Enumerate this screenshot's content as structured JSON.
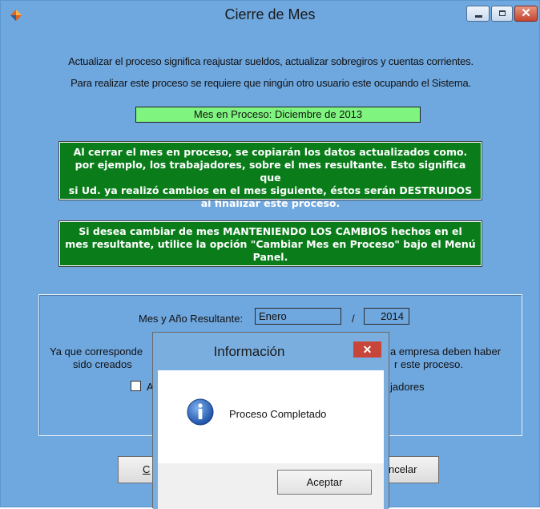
{
  "window": {
    "title": "Cierre de Mes",
    "minimize_glyph": "",
    "close_glyph": "✕"
  },
  "info": {
    "line1": "Actualizar el proceso significa reajustar sueldos, actualizar sobregiros y cuentas corrientes.",
    "line2": "Para realizar este proceso se requiere que ningún otro usuario este ocupando el Sistema."
  },
  "mes_en_proceso": "Mes en Proceso: Diciembre de 2013",
  "warning1": {
    "line1": "Al cerrar el mes en proceso, se copiarán los datos actualizados como.",
    "line2": "por ejemplo, los trabajadores, sobre el mes resultante. Esto significa que",
    "line3": "si Ud. ya realizó cambios en el mes siguiente, éstos serán DESTRUIDOS",
    "line4": "al finalizar este proceso."
  },
  "warning2": {
    "line1": "Si desea cambiar de mes MANTENIENDO LOS CAMBIOS hechos en el",
    "line2": "mes resultante, utilice la opción \"Cambiar Mes en Proceso\" bajo el Menú",
    "line3": "Panel."
  },
  "resultante": {
    "label": "Mes y Año Resultante:",
    "month_value": "Enero",
    "separator": "/",
    "year_value": "2014"
  },
  "note": {
    "left_line1": "Ya que corresponde",
    "left_line2": "sido creados",
    "right_line1": "a empresa deben haber",
    "right_line2": "r este proceso."
  },
  "checkbox": {
    "left_text": "A",
    "right_text": "jadores"
  },
  "buttons": {
    "left_label": "C",
    "right_label": "ncelar"
  },
  "dialog": {
    "title": "Información",
    "close_glyph": "✕",
    "icon": "info-icon",
    "message": "Proceso Completado",
    "ok_label": "Aceptar"
  },
  "colors": {
    "window_bg": "#6fa7df",
    "green_box": "#0a7d1a",
    "mes_box": "#7ff57f",
    "close_red": "#c8453a"
  }
}
